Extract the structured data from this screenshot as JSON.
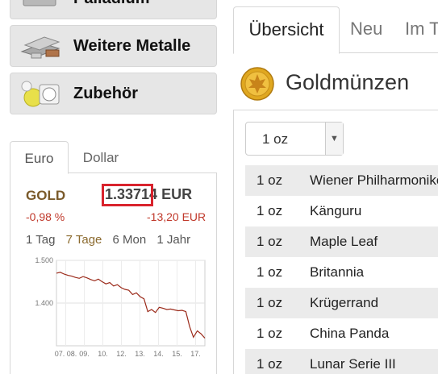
{
  "nav": {
    "items": [
      {
        "label": "Palladium",
        "icon": "palladium-bars-icon"
      },
      {
        "label": "Weitere Metalle",
        "icon": "metal-bars-icon"
      },
      {
        "label": "Zubehör",
        "icon": "coin-capsule-icon"
      }
    ]
  },
  "widget": {
    "tabs": [
      "Euro",
      "Dollar"
    ],
    "active_tab": "Euro",
    "metal": "GOLD",
    "price_main": "1.337",
    "price_rest": "14 EUR",
    "change_pct": "-0,98 %",
    "change_abs": "-13,20 EUR",
    "periods": [
      "1 Tag",
      "7 Tage",
      "6 Mon",
      "1 Jahr"
    ],
    "active_period": "7 Tage",
    "highlight_color": "#d9232d",
    "negative_color": "#c0392b"
  },
  "chart_data": {
    "type": "line",
    "y_ticks": [
      "1.500",
      "1.400"
    ],
    "x_ticks": [
      "07. 08.",
      "09.",
      "10.",
      "12.",
      "13.",
      "14.",
      "15.",
      "17."
    ],
    "ylim": [
      1300,
      1500
    ],
    "grid": true,
    "series": [
      {
        "values": [
          1470,
          1472,
          1468,
          1465,
          1463,
          1460,
          1458,
          1462,
          1459,
          1455,
          1452,
          1456,
          1450,
          1445,
          1448,
          1440,
          1443,
          1436,
          1432,
          1430,
          1420,
          1424,
          1415,
          1410,
          1380,
          1385,
          1378,
          1390,
          1388,
          1385,
          1386,
          1384,
          1382,
          1383,
          1380,
          1345,
          1320,
          1335,
          1328,
          1318
        ]
      }
    ],
    "line_color": "#9b2a1a"
  },
  "main": {
    "tabs": [
      "Übersicht",
      "Neu",
      "Im T"
    ],
    "active_tab": "Übersicht",
    "heading": "Goldmünzen",
    "filter": {
      "selected": "1 oz"
    },
    "coins": [
      {
        "weight": "1 oz",
        "name": "Wiener Philharmoniker"
      },
      {
        "weight": "1 oz",
        "name": "Känguru"
      },
      {
        "weight": "1 oz",
        "name": "Maple Leaf"
      },
      {
        "weight": "1 oz",
        "name": "Britannia"
      },
      {
        "weight": "1 oz",
        "name": "Krügerrand"
      },
      {
        "weight": "1 oz",
        "name": "China Panda"
      },
      {
        "weight": "1 oz",
        "name": "Lunar Serie III"
      }
    ]
  }
}
